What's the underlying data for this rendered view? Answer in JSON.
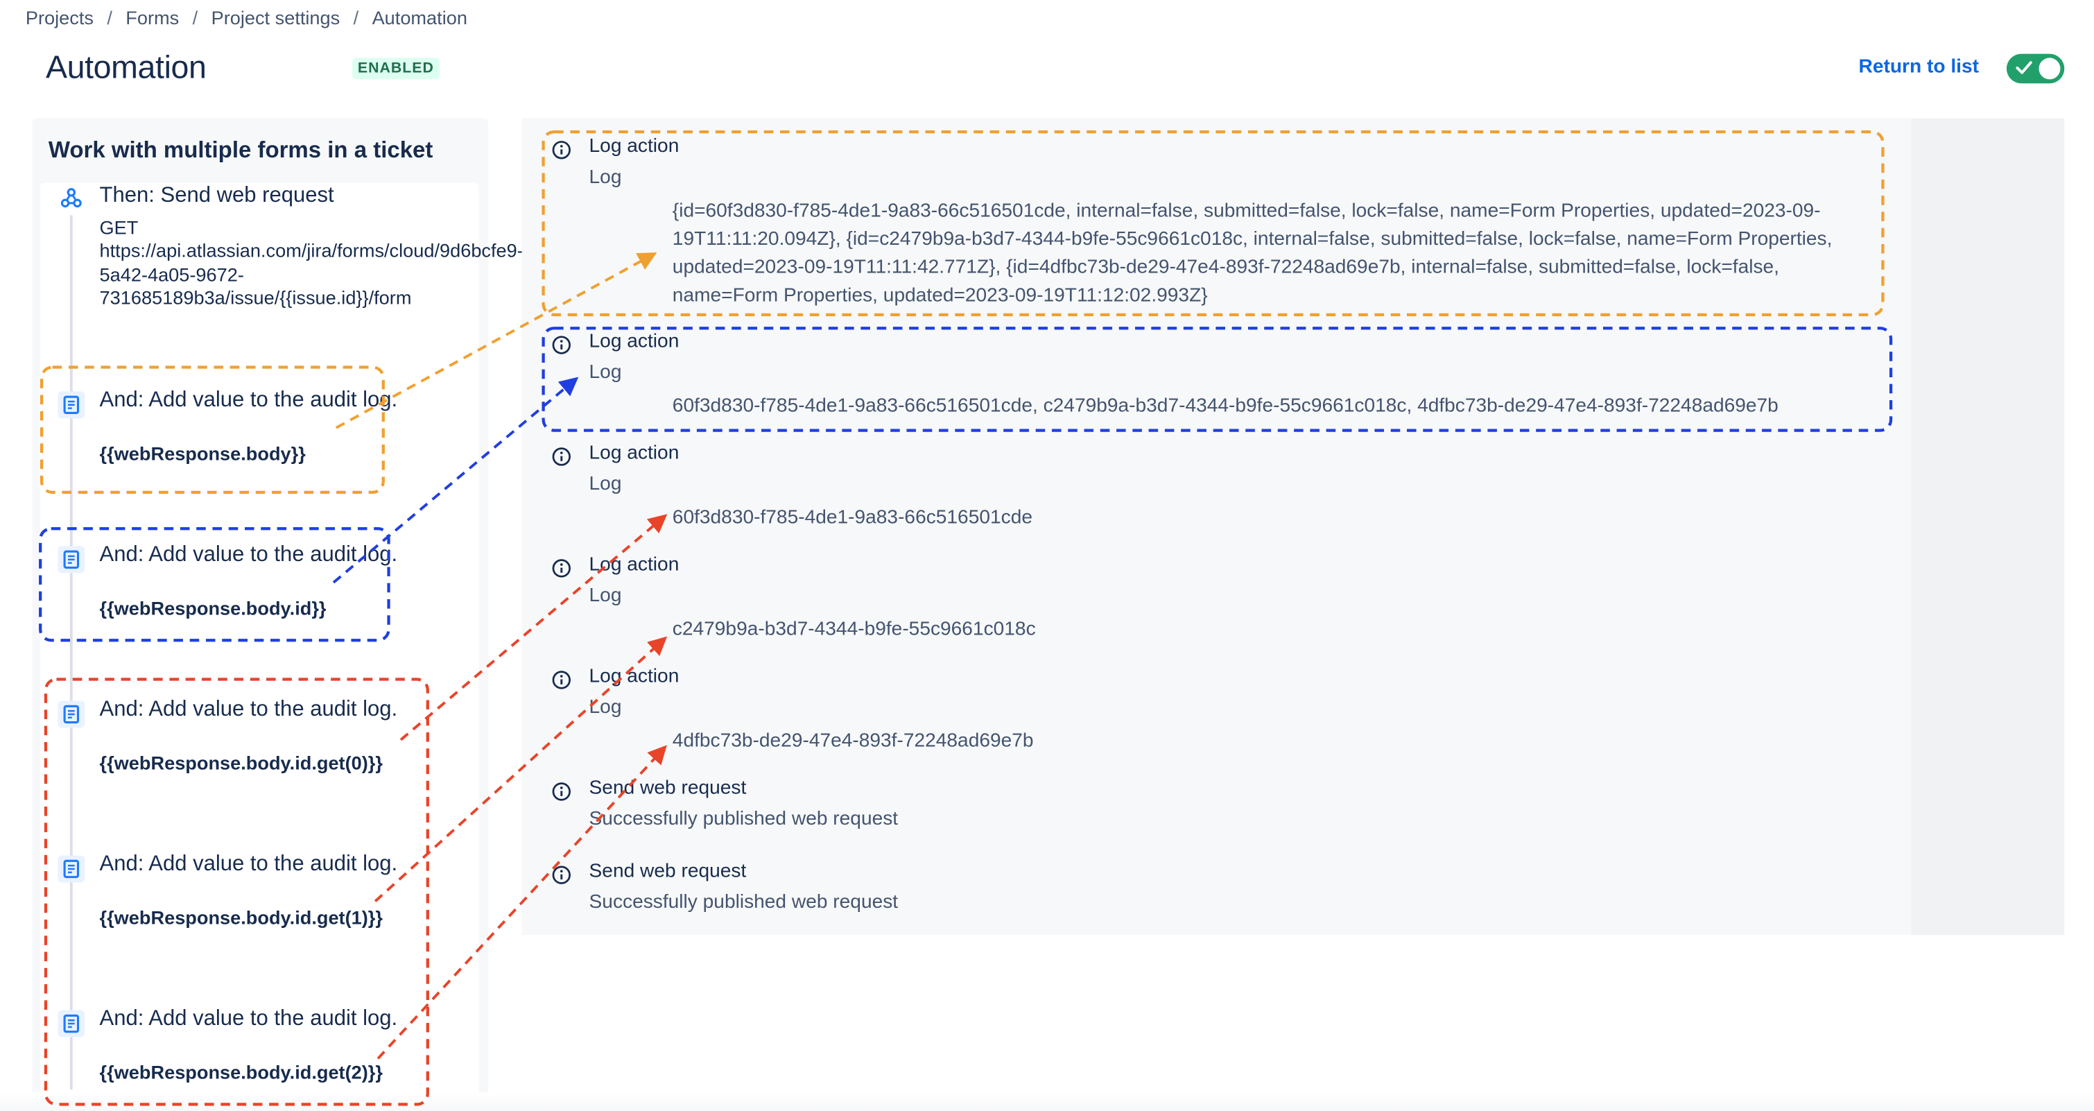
{
  "breadcrumb": [
    "Projects",
    "Forms",
    "Project settings",
    "Automation"
  ],
  "header": {
    "title": "Automation",
    "status": "ENABLED",
    "return_label": "Return to list"
  },
  "rule": {
    "title": "Work with multiple forms in a ticket",
    "steps": [
      {
        "title": "Then: Send web request",
        "detail": "GET https://api.atlassian.com/jira/forms/cloud/9d6bcfe9-5a42-4a05-9672-731685189b3a/issue/{{issue.id}}/form",
        "icon": "webhook-icon"
      },
      {
        "title": "And: Add value to the audit log.",
        "value": "{{webResponse.body}}",
        "icon": "audit-log-icon"
      },
      {
        "title": "And: Add value to the audit log.",
        "value": "{{webResponse.body.id}}",
        "icon": "audit-log-icon"
      },
      {
        "title": "And: Add value to the audit log.",
        "value": "{{webResponse.body.id.get(0)}}",
        "icon": "audit-log-icon"
      },
      {
        "title": "And: Add value to the audit log.",
        "value": "{{webResponse.body.id.get(1)}}",
        "icon": "audit-log-icon"
      },
      {
        "title": "And: Add value to the audit log.",
        "value": "{{webResponse.body.id.get(2)}}",
        "icon": "audit-log-icon"
      }
    ]
  },
  "log": {
    "entries": [
      {
        "title": "Log action",
        "sub": "Log",
        "message": "{id=60f3d830-f785-4de1-9a83-66c516501cde, internal=false, submitted=false, lock=false, name=Form Properties, updated=2023-09-19T11:11:20.094Z}, {id=c2479b9a-b3d7-4344-b9fe-55c9661c018c, internal=false, submitted=false, lock=false, name=Form Properties, updated=2023-09-19T11:11:42.771Z}, {id=4dfbc73b-de29-47e4-893f-72248ad69e7b, internal=false, submitted=false, lock=false, name=Form Properties, updated=2023-09-19T11:12:02.993Z}"
      },
      {
        "title": "Log action",
        "sub": "Log",
        "message": "60f3d830-f785-4de1-9a83-66c516501cde, c2479b9a-b3d7-4344-b9fe-55c9661c018c, 4dfbc73b-de29-47e4-893f-72248ad69e7b"
      },
      {
        "title": "Log action",
        "sub": "Log",
        "message": "60f3d830-f785-4de1-9a83-66c516501cde"
      },
      {
        "title": "Log action",
        "sub": "Log",
        "message": "c2479b9a-b3d7-4344-b9fe-55c9661c018c"
      },
      {
        "title": "Log action",
        "sub": "Log",
        "message": "4dfbc73b-de29-47e4-893f-72248ad69e7b"
      },
      {
        "title": "Send web request",
        "sub": "Successfully published web request"
      },
      {
        "title": "Send web request",
        "sub": "Successfully published web request"
      }
    ]
  },
  "colors": {
    "annotation_orange": "#f0a030",
    "annotation_blue": "#1f3fe0",
    "annotation_red": "#e8442a",
    "enabled_badge": "#dcfff1",
    "toggle_on": "#22a06b",
    "link": "#0c66e4"
  }
}
